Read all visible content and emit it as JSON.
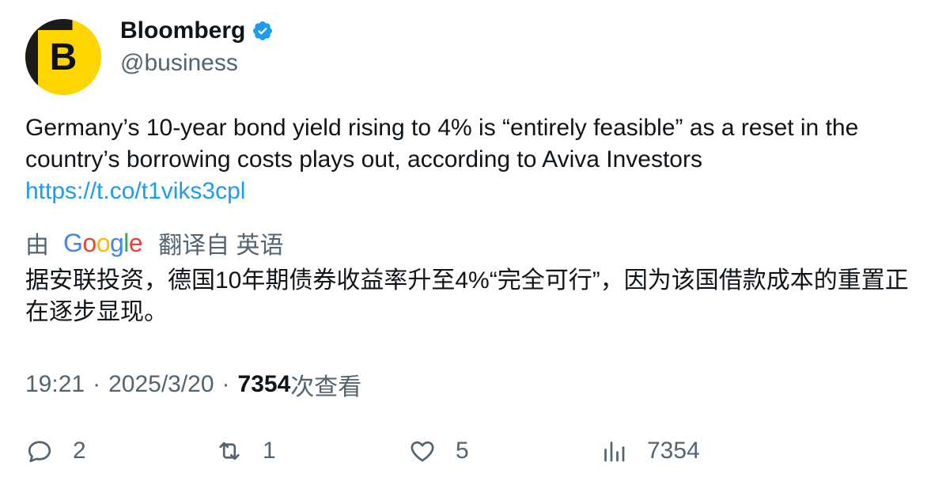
{
  "author": {
    "display_name": "Bloomberg",
    "handle": "@business",
    "avatar_letter": "B",
    "avatar_color": "#ffd500",
    "verified_color": "#1d9bf0"
  },
  "tweet": {
    "text": "Germany’s 10-year bond yield rising to 4% is “entirely feasible” as a reset in the country’s borrowing costs plays out, according to Aviva Investors",
    "link": "https://t.co/t1viks3cpl"
  },
  "translation": {
    "prefix": "由",
    "provider": "Google",
    "suffix": "翻译自 英语",
    "text": "据安联投资，德国10年期债券收益率升至4%“完全可行”，因为该国借款成本的重置正在逐步显现。"
  },
  "meta": {
    "time": "19:21",
    "separator": "·",
    "date": "2025/3/20",
    "views_count": "7354",
    "views_label": "次查看"
  },
  "actions": {
    "replies": "2",
    "retweets": "1",
    "likes": "5",
    "views": "7354"
  },
  "colors": {
    "text": "#0f1419",
    "secondary": "#536471",
    "link": "#1d9bf0"
  }
}
